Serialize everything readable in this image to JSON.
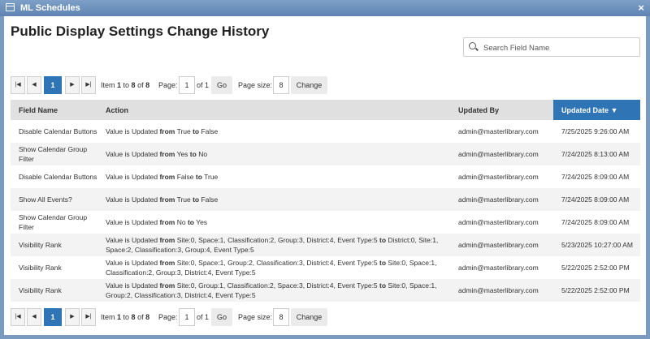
{
  "window": {
    "title": "ML Schedules",
    "close_icon": "×"
  },
  "page": {
    "heading": "Public Display Settings Change History"
  },
  "search": {
    "placeholder": "Search Field Name"
  },
  "pager": {
    "current_page": "1",
    "item_prefix": "Item ",
    "item_from": "1",
    "item_to_word": " to ",
    "item_to": "8",
    "item_of_word": " of ",
    "item_total": "8",
    "page_label": "Page:",
    "page_value": "1",
    "of_pages": "of 1",
    "go_label": "Go",
    "page_size_label": "Page size:",
    "page_size_value": "8",
    "change_label": "Change",
    "first_icon": "|◀",
    "prev_icon": "◀",
    "next_icon": "▶",
    "last_icon": "▶|"
  },
  "table": {
    "columns": [
      "Field Name",
      "Action",
      "Updated By",
      "Updated Date ▼"
    ],
    "rows": [
      {
        "field": "Disable Calendar Buttons",
        "action": [
          "Value is Updated ",
          "from",
          " True ",
          "to",
          " False"
        ],
        "by": "admin@masterlibrary.com",
        "date": "7/25/2025 9:26:00 AM"
      },
      {
        "field": "Show Calendar Group Filter",
        "action": [
          "Value is Updated ",
          "from",
          " Yes ",
          "to",
          " No"
        ],
        "by": "admin@masterlibrary.com",
        "date": "7/24/2025 8:13:00 AM"
      },
      {
        "field": "Disable Calendar Buttons",
        "action": [
          "Value is Updated ",
          "from",
          " False ",
          "to",
          " True"
        ],
        "by": "admin@masterlibrary.com",
        "date": "7/24/2025 8:09:00 AM"
      },
      {
        "field": "Show All Events?",
        "action": [
          "Value is Updated ",
          "from",
          " True ",
          "to",
          " False"
        ],
        "by": "admin@masterlibrary.com",
        "date": "7/24/2025 8:09:00 AM"
      },
      {
        "field": "Show Calendar Group Filter",
        "action": [
          "Value is Updated ",
          "from",
          " No ",
          "to",
          " Yes"
        ],
        "by": "admin@masterlibrary.com",
        "date": "7/24/2025 8:09:00 AM"
      },
      {
        "field": "Visibility Rank",
        "action": [
          "Value is Updated ",
          "from",
          " Site:0, Space:1, Classification:2, Group:3, District:4, Event Type:5 ",
          "to",
          " District:0, Site:1, Space:2, Classification:3, Group:4, Event Type:5"
        ],
        "by": "admin@masterlibrary.com",
        "date": "5/23/2025 10:27:00 AM"
      },
      {
        "field": "Visibility Rank",
        "action": [
          "Value is Updated ",
          "from",
          " Site:0, Space:1, Group:2, Classification:3, District:4, Event Type:5 ",
          "to",
          " Site:0, Space:1, Classification:2, Group:3, District:4, Event Type:5"
        ],
        "by": "admin@masterlibrary.com",
        "date": "5/22/2025 2:52:00 PM"
      },
      {
        "field": "Visibility Rank",
        "action": [
          "Value is Updated ",
          "from",
          " Site:0, Group:1, Classification:2, Space:3, District:4, Event Type:5 ",
          "to",
          " Site:0, Space:1, Group:2, Classification:3, District:4, Event Type:5"
        ],
        "by": "admin@masterlibrary.com",
        "date": "5/22/2025 2:52:00 PM"
      }
    ]
  }
}
